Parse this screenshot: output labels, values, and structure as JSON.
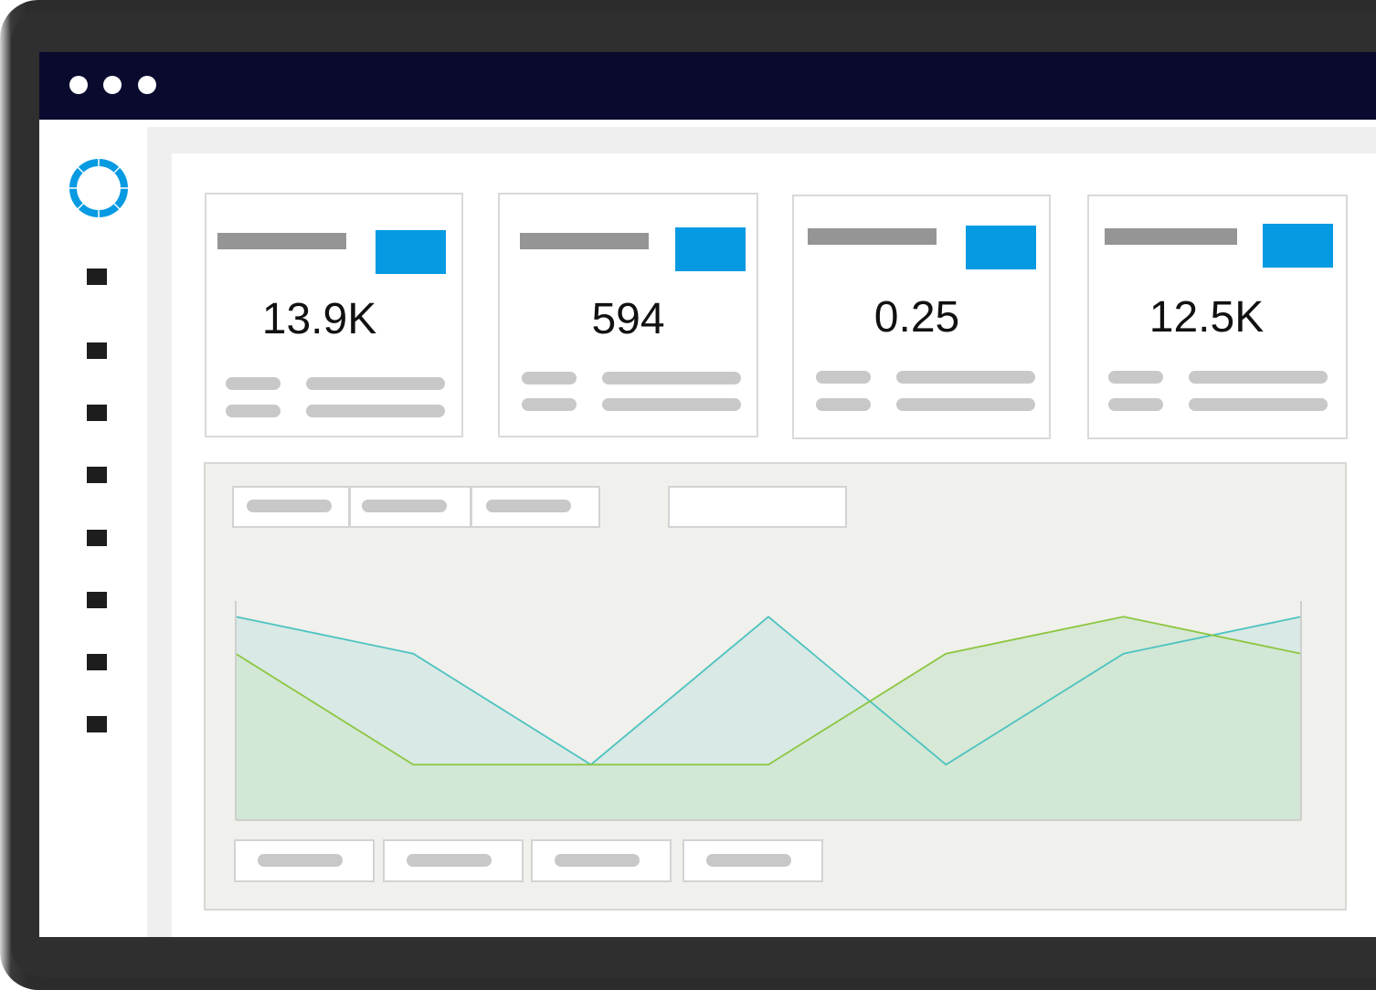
{
  "window": {
    "controls": [
      "window-dot",
      "window-dot",
      "window-dot"
    ]
  },
  "sidebar": {
    "logo_icon": "ring-logo-icon",
    "items": [
      {
        "icon": "nav-square-icon"
      },
      {
        "icon": "nav-square-icon"
      },
      {
        "icon": "nav-square-icon"
      },
      {
        "icon": "nav-square-icon"
      },
      {
        "icon": "nav-square-icon"
      },
      {
        "icon": "nav-square-icon"
      },
      {
        "icon": "nav-square-icon"
      },
      {
        "icon": "nav-square-icon"
      }
    ]
  },
  "kpi_cards": [
    {
      "value": "13.9K"
    },
    {
      "value": "594"
    },
    {
      "value": "0.25"
    },
    {
      "value": "12.5K"
    }
  ],
  "colors": {
    "titlebar": "#090a2e",
    "accent": "#059ae2",
    "series_teal": "#4cc3c0",
    "series_green": "#8cc63f",
    "area_teal_fill": "#d9e9e5",
    "area_green_fill": "#cfe6cf"
  },
  "chart_data": {
    "type": "area",
    "x": [
      0,
      1,
      2,
      3,
      4,
      5,
      6
    ],
    "ylim": [
      0,
      4
    ],
    "grid": false,
    "series": [
      {
        "values": [
          3.3,
          2.7,
          0.9,
          3.3,
          0.9,
          2.7,
          3.3
        ],
        "color": "#4cc3c0"
      },
      {
        "values": [
          2.7,
          0.9,
          0.9,
          0.9,
          2.7,
          3.3,
          2.7
        ],
        "color": "#8cc63f"
      }
    ]
  }
}
